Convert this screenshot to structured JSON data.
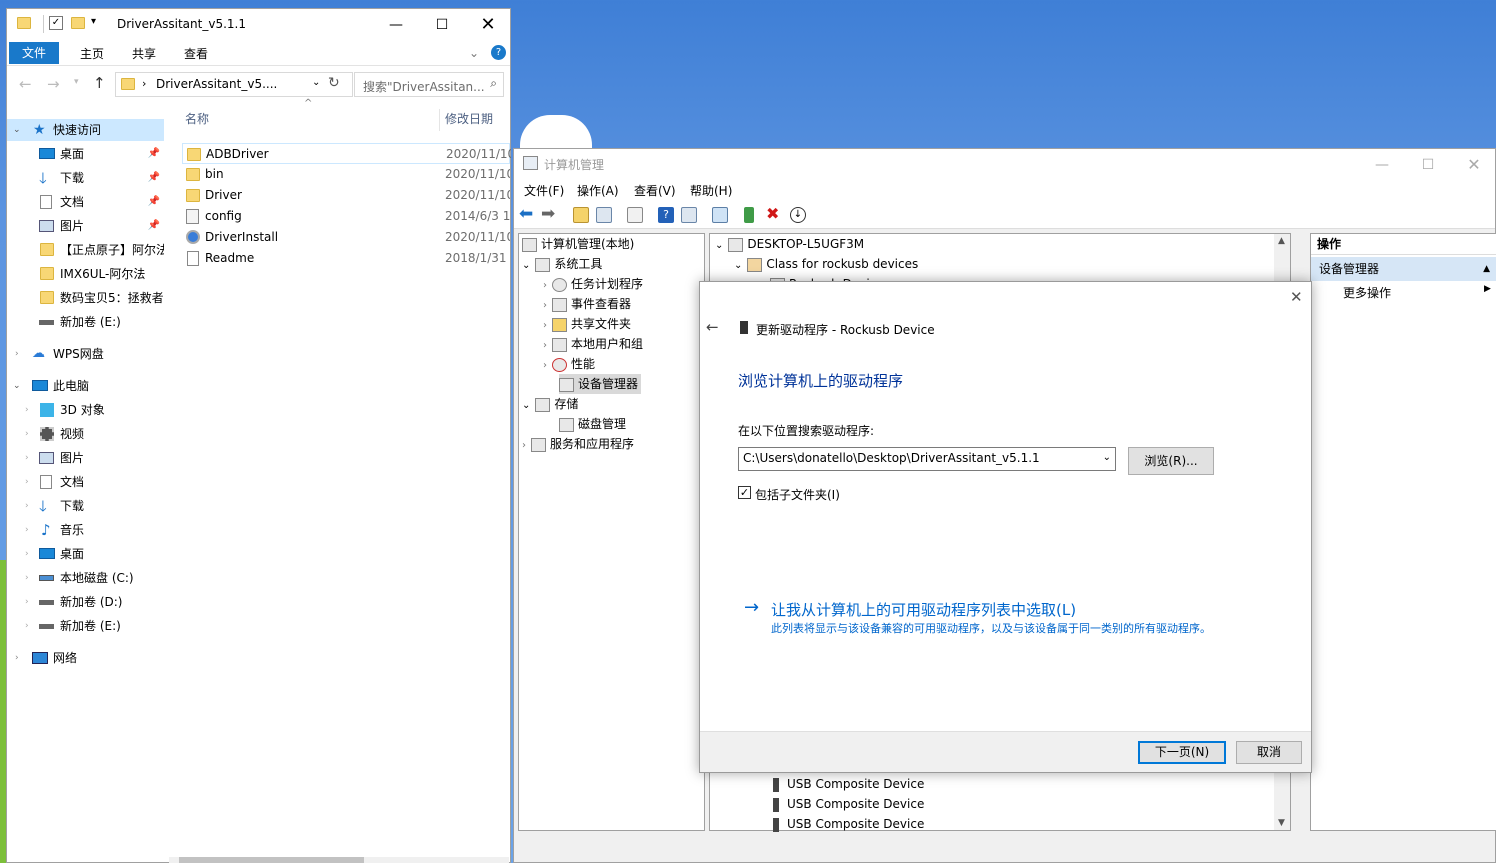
{
  "explorer": {
    "title": "DriverAssitant_v5.1.1",
    "ribbon_tabs": [
      "文件",
      "主页",
      "共享",
      "查看"
    ],
    "address": "DriverAssitant_v5....",
    "search_placeholder": "搜索\"DriverAssitan...",
    "nav": {
      "quick_access": "快速访问",
      "desktop": "桌面",
      "downloads": "下载",
      "documents": "文档",
      "pictures": "图片",
      "folder1": "【正点原子】阿尔法",
      "folder2": "IMX6UL-阿尔法",
      "folder3": "数码宝贝5：拯救者",
      "drive_e_quick": "新加卷 (E:)",
      "wps": "WPS网盘",
      "this_pc": "此电脑",
      "objects3d": "3D 对象",
      "videos": "视频",
      "pc_pictures": "图片",
      "pc_documents": "文档",
      "pc_downloads": "下载",
      "music": "音乐",
      "pc_desktop": "桌面",
      "drive_c": "本地磁盘 (C:)",
      "drive_d": "新加卷 (D:)",
      "drive_e": "新加卷 (E:)",
      "network": "网络"
    },
    "columns": {
      "name": "名称",
      "modified": "修改日期"
    },
    "files": [
      {
        "name": "ADBDriver",
        "date": "2020/11/10"
      },
      {
        "name": "bin",
        "date": "2020/11/10"
      },
      {
        "name": "Driver",
        "date": "2020/11/10"
      },
      {
        "name": "config",
        "date": "2014/6/3 1"
      },
      {
        "name": "DriverInstall",
        "date": "2020/11/10"
      },
      {
        "name": "Readme",
        "date": "2018/1/31"
      }
    ]
  },
  "cm": {
    "title": "计算机管理",
    "menus": [
      "文件(F)",
      "操作(A)",
      "查看(V)",
      "帮助(H)"
    ],
    "tree": {
      "root": "计算机管理(本地)",
      "system_tools": "系统工具",
      "task_scheduler": "任务计划程序",
      "event_viewer": "事件查看器",
      "shared_folders": "共享文件夹",
      "local_users": "本地用户和组",
      "performance": "性能",
      "device_manager": "设备管理器",
      "storage": "存储",
      "disk_management": "磁盘管理",
      "services": "服务和应用程序"
    },
    "devices": {
      "computer": "DESKTOP-L5UGF3M",
      "class": "Class for rockusb devices",
      "rockusb": "Rockusb Device",
      "usb": [
        "USB Composite Device",
        "USB Composite Device",
        "USB Composite Device"
      ]
    },
    "actions": {
      "header": "操作",
      "selected": "设备管理器",
      "more": "更多操作"
    }
  },
  "dialog": {
    "title": "更新驱动程序 - Rockusb Device",
    "heading": "浏览计算机上的驱动程序",
    "search_label": "在以下位置搜索驱动程序:",
    "path": "C:\\Users\\donatello\\Desktop\\DriverAssitant_v5.1.1",
    "browse": "浏览(R)...",
    "include_sub": "包括子文件夹(I)",
    "link": "让我从计算机上的可用驱动程序列表中选取(L)",
    "link_desc": "此列表将显示与该设备兼容的可用驱动程序，以及与该设备属于同一类别的所有驱动程序。",
    "next": "下一页(N)",
    "cancel": "取消"
  }
}
